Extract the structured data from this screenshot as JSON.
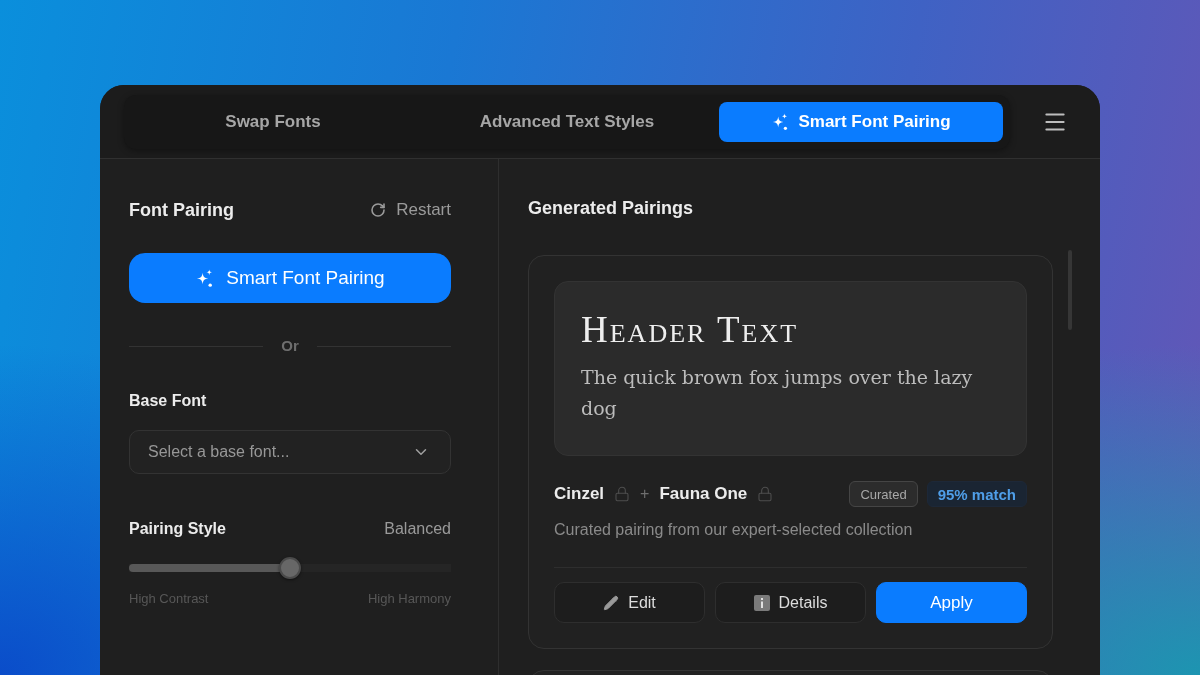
{
  "tabs": [
    {
      "label": "Swap Fonts",
      "kind": "plain",
      "selected": false
    },
    {
      "label": "Advanced Text Styles",
      "kind": "plain",
      "selected": false
    },
    {
      "label": "Smart Font Pairing",
      "kind": "ai",
      "selected": true
    }
  ],
  "font_pairing": {
    "title": "Font Pairing",
    "restart": "Restart",
    "smart_button": "Smart Font Pairing",
    "divider_text": "Or",
    "base_font": {
      "label": "Base Font",
      "placeholder": "Select a base font..."
    },
    "pairing_style": {
      "label": "Pairing Style",
      "value": "Balanced",
      "level": 0.5,
      "min_label": "High Contrast",
      "max_label": "High Harmony"
    }
  },
  "generated_pairings": {
    "title": "Generated Pairings",
    "pairings": [
      {
        "preview": {
          "header": "Header Text",
          "body": "The quick brown fox jumps over the lazy dog"
        },
        "fonts": [
          {
            "name": "Cinzel",
            "locked": false
          },
          {
            "name": "Fauna One",
            "locked": false
          }
        ],
        "joiner": "+",
        "badges": [
          {
            "label": "Curated",
            "kind": "tag"
          },
          {
            "label": "95% match",
            "kind": "match"
          }
        ],
        "description": "Curated pairing from our expert-selected collection",
        "actions": [
          {
            "label": "Edit",
            "kind": "edit"
          },
          {
            "label": "Details",
            "kind": "details"
          },
          {
            "label": "Apply",
            "kind": "apply"
          }
        ]
      }
    ]
  }
}
